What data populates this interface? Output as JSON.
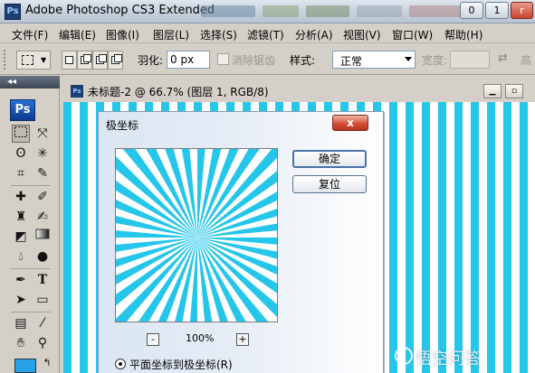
{
  "app": {
    "logo": "Ps",
    "title": "Adobe Photoshop CS3 Extended",
    "window_buttons": [
      "0",
      "1",
      "r"
    ]
  },
  "menubar": {
    "items": [
      "文件(F)",
      "编辑(E)",
      "图像(I)",
      "图层(L)",
      "选择(S)",
      "滤镜(T)",
      "分析(A)",
      "视图(V)",
      "窗口(W)",
      "帮助(H)"
    ]
  },
  "options": {
    "feather_label": "羽化:",
    "feather_value": "0 px",
    "antialias_label": "消除锯齿",
    "style_label": "样式:",
    "style_value": "正常",
    "width_label": "宽度:",
    "height_label": "高"
  },
  "toolbox": {
    "logo": "Ps",
    "collapse": "◂◂",
    "tools": [
      "marquee",
      "move",
      "lasso",
      "magic-wand",
      "crop",
      "slice",
      "healing",
      "brush",
      "clone-stamp",
      "history-brush",
      "eraser",
      "gradient",
      "blur",
      "dodge",
      "pen",
      "type",
      "path-selection",
      "shape",
      "notes",
      "eyedropper",
      "hand",
      "zoom"
    ],
    "foreground_color": "#26a1e6"
  },
  "document": {
    "icon": "Ps",
    "title": "未标题-2 @ 66.7% (图层 1, RGB/8)",
    "stripe_colors": [
      "#25c6ea",
      "#ffffff"
    ]
  },
  "dialog": {
    "title": "极坐标",
    "close": "x",
    "ok_label": "确定",
    "reset_label": "复位",
    "zoom_out": "-",
    "zoom_in": "+",
    "zoom_value": "100%",
    "radio_label": "平面坐标到极坐标(R)"
  },
  "watermark": {
    "text": "悟空问答"
  }
}
